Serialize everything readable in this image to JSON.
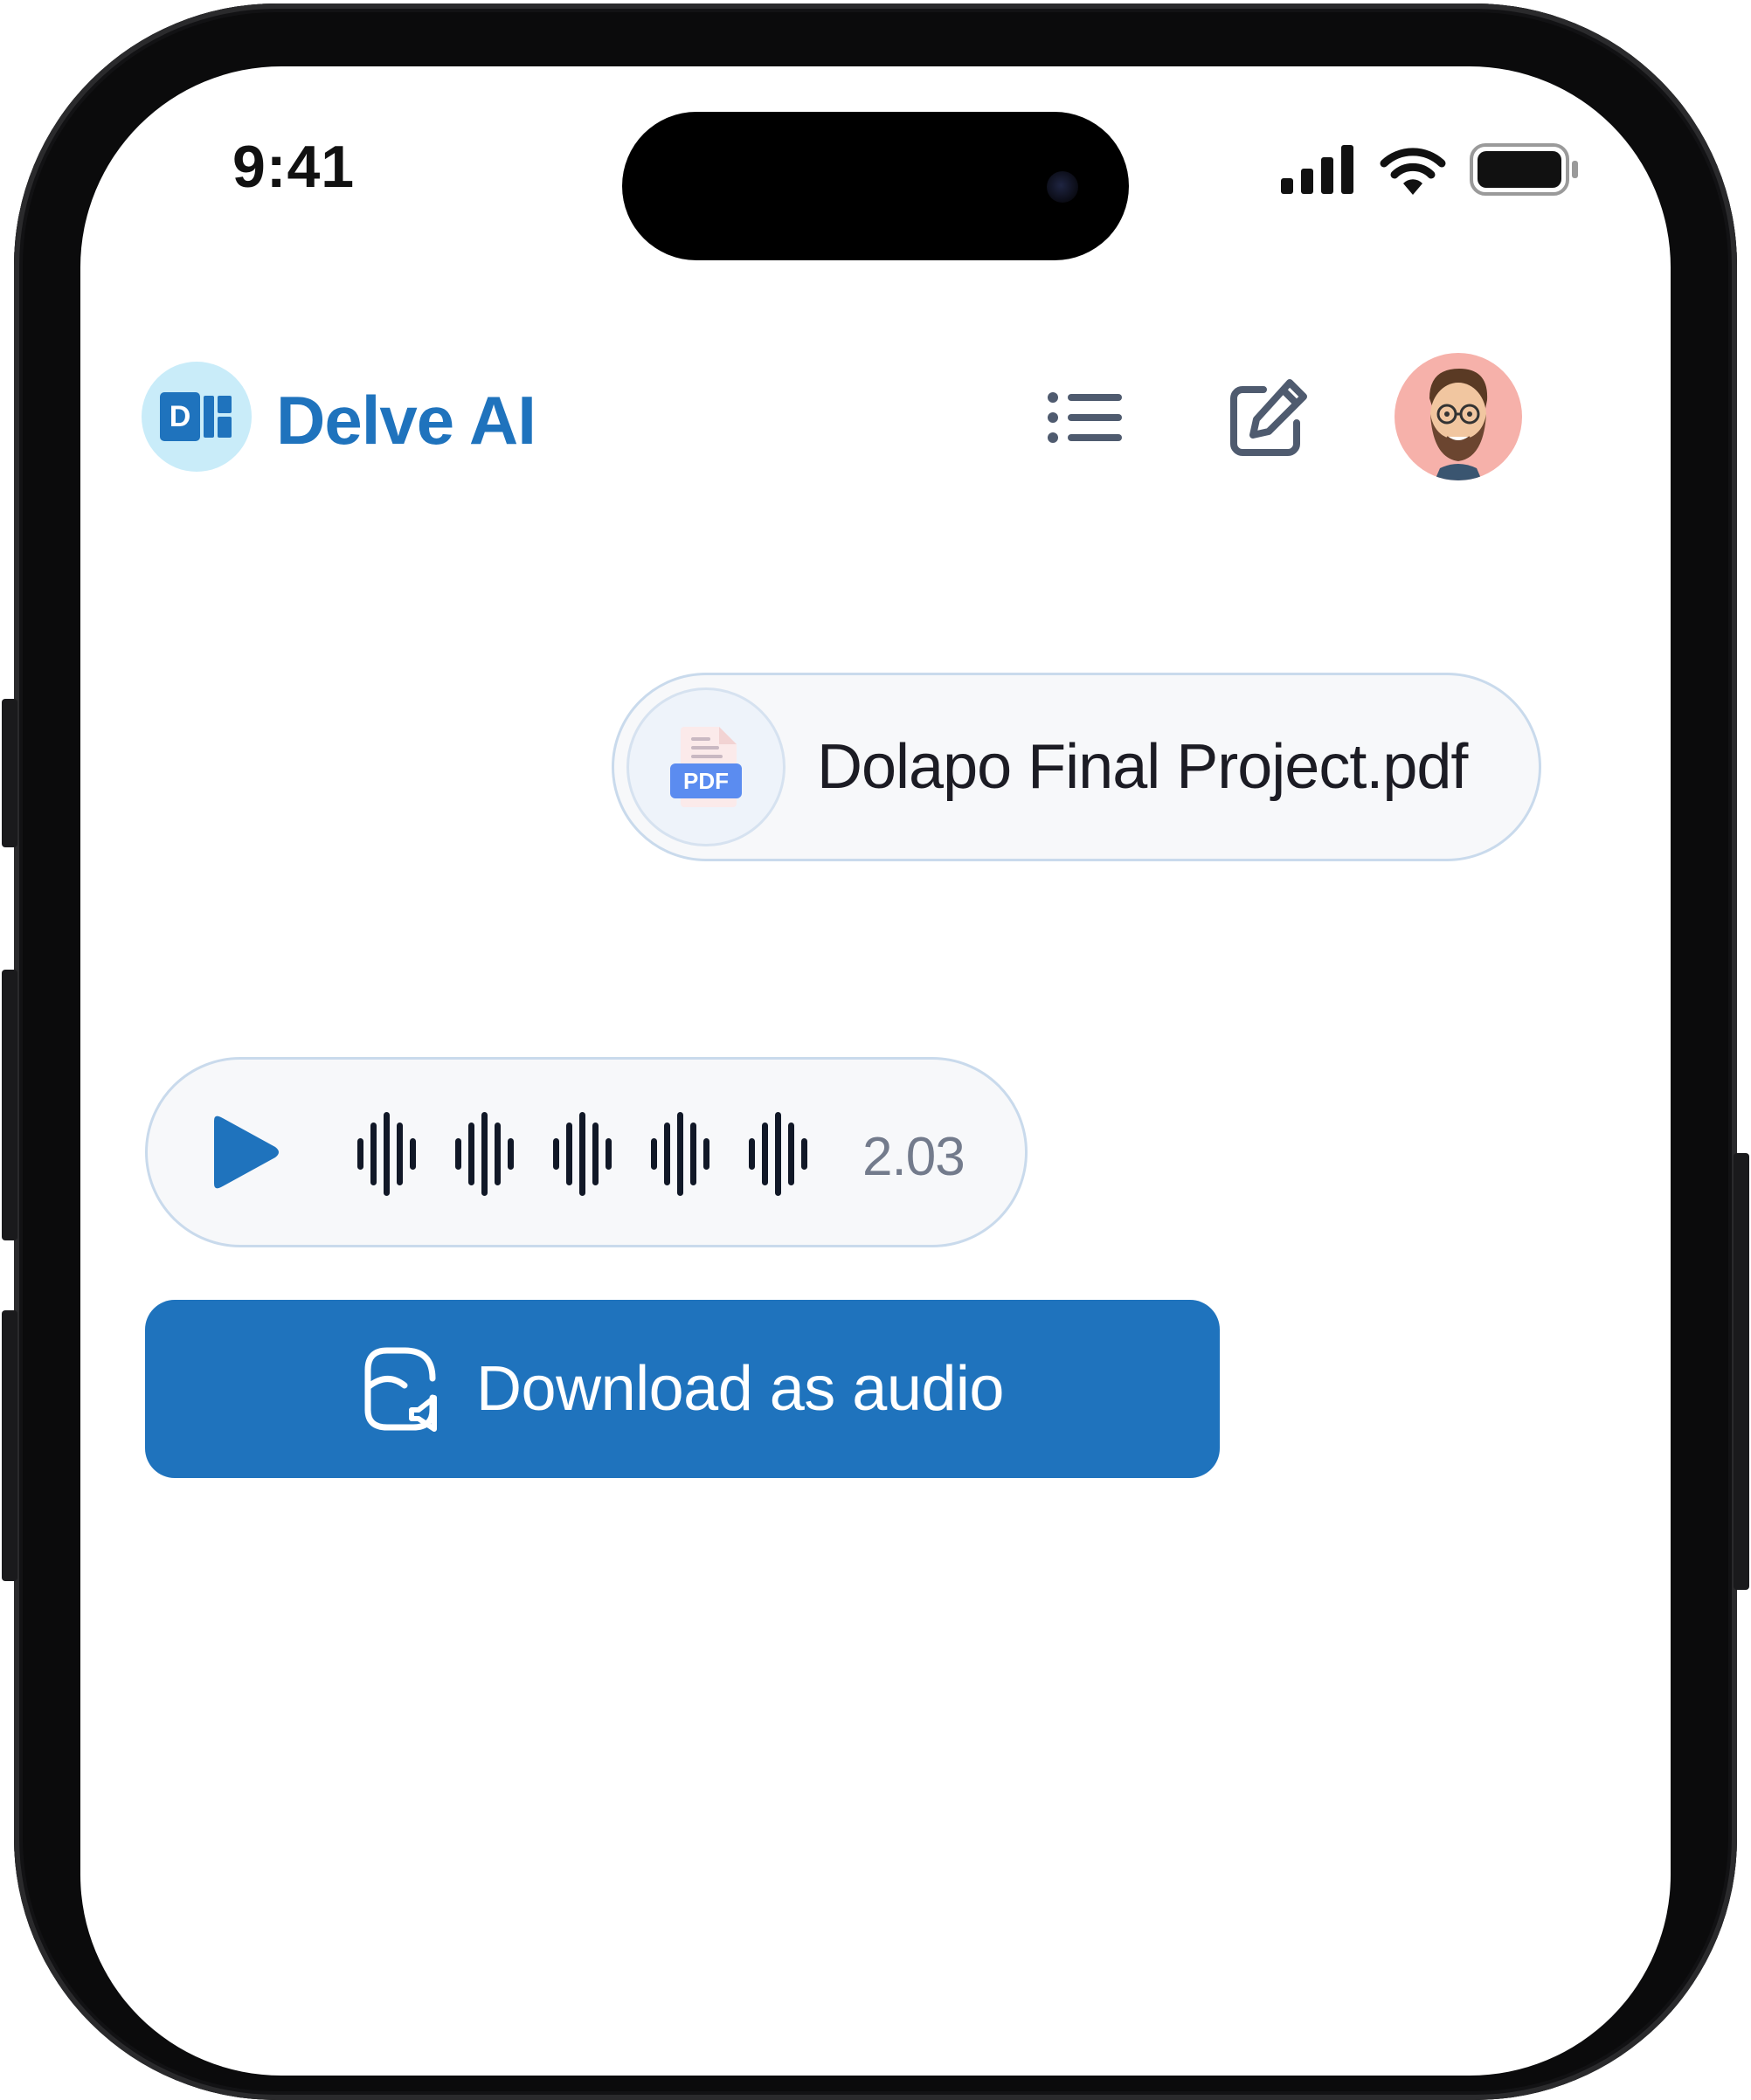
{
  "status_bar": {
    "time": "9:41",
    "icons": [
      "cellular-signal-icon",
      "wifi-icon",
      "battery-icon"
    ]
  },
  "header": {
    "app_name": "Delve AI",
    "logo_letter": "D",
    "menu_icon": "list-icon",
    "new_chat_icon": "edit-icon"
  },
  "chat": {
    "file_message": {
      "file_name": "Dolapo Final Project.pdf",
      "file_type_label": "PDF",
      "icon": "pdf-file-icon"
    },
    "audio_message": {
      "icon": "play-icon",
      "duration": "2.03"
    },
    "download_button": {
      "label": "Download as audio",
      "icon": "audio-file-icon"
    }
  },
  "colors": {
    "brand": "#1f73bd",
    "logo_background": "#c9ecf9",
    "avatar_background": "#f6b1aa",
    "bubble_background": "#f7f8fa",
    "bubble_border": "#c9daec",
    "duration_text": "#737b8c"
  }
}
